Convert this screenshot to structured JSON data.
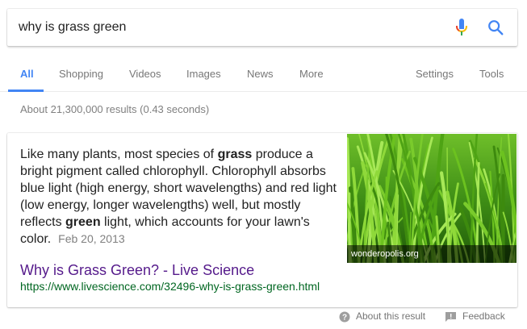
{
  "search": {
    "query": "why is grass green"
  },
  "tabs": [
    {
      "label": "All"
    },
    {
      "label": "Shopping"
    },
    {
      "label": "Videos"
    },
    {
      "label": "Images"
    },
    {
      "label": "News"
    },
    {
      "label": "More"
    },
    {
      "label": "Settings"
    },
    {
      "label": "Tools"
    }
  ],
  "stats": "About 21,300,000 results (0.43 seconds)",
  "featured": {
    "snippet_parts": [
      "Like many plants, most species of ",
      "grass",
      " produce a bright pigment called chlorophyll. Chlorophyll absorbs blue light (high energy, short wavelengths) and red light (low energy, longer wavelengths) well, but mostly reflects ",
      "green",
      " light, which accounts for your lawn's color."
    ],
    "date": "Feb 20, 2013",
    "title": "Why is Grass Green? - Live Science",
    "url": "https://www.livescience.com/32496-why-is-grass-green.html",
    "image_caption": "wonderopolis.org"
  },
  "footer": {
    "about": "About this result",
    "feedback": "Feedback"
  },
  "icons": {
    "mic": "microphone-icon",
    "search": "search-icon",
    "about": "question-circle-icon",
    "feedback": "feedback-icon"
  },
  "colors": {
    "accent": "#4285f4",
    "link": "#551a8b",
    "url": "#006621"
  }
}
